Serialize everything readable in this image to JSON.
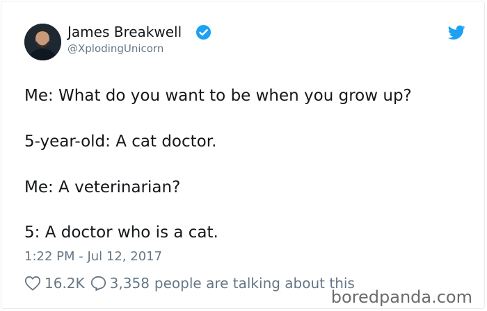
{
  "author": {
    "display_name": "James Breakwell",
    "handle": "@XplodingUnicorn",
    "verified": true
  },
  "icons": {
    "verified": "verified-badge-icon",
    "brand": "twitter-bird-icon",
    "like": "heart-icon",
    "reply": "speech-bubble-icon"
  },
  "tweet": {
    "lines": [
      "Me: What do you want to be when you grow up?",
      "5-year-old: A cat doctor.",
      "Me: A veterinarian?",
      "5: A doctor who is a cat."
    ],
    "timestamp": "1:22 PM - Jul 12, 2017"
  },
  "stats": {
    "likes": "16.2K",
    "talking_count": "3,358",
    "talking_label": "people are talking about this"
  },
  "watermark": "boredpanda.com",
  "colors": {
    "text": "#14171a",
    "secondary": "#657786",
    "twitter_blue": "#1da1f2",
    "border": "#e6ecf0"
  }
}
